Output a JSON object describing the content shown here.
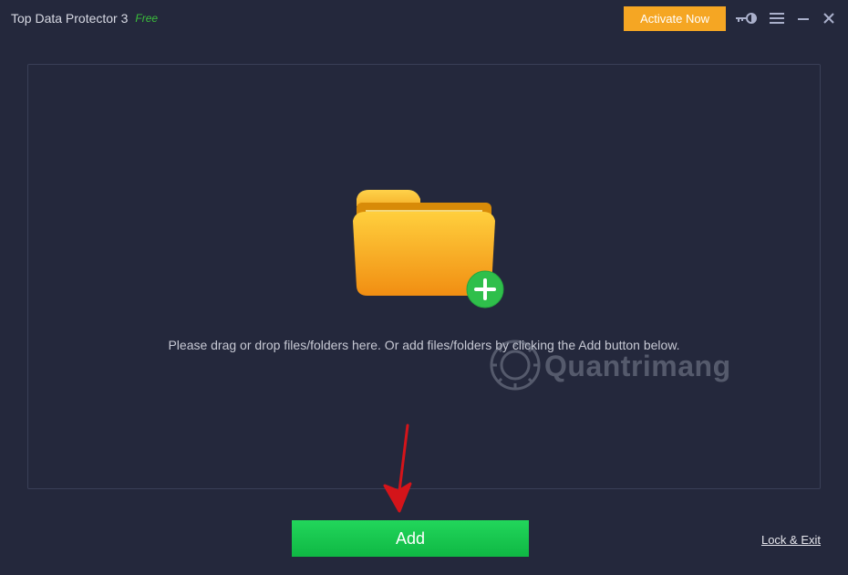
{
  "titlebar": {
    "title": "Top Data Protector 3",
    "edition": "Free",
    "activate_label": "Activate Now"
  },
  "main": {
    "instruction": "Please drag or drop files/folders here. Or add files/folders by clicking the Add button below."
  },
  "footer": {
    "add_label": "Add",
    "lock_exit_label": "Lock & Exit"
  },
  "watermark": {
    "text": "Quantrimang"
  },
  "annotation": {
    "purpose": "Red arrow pointing to Add button"
  }
}
